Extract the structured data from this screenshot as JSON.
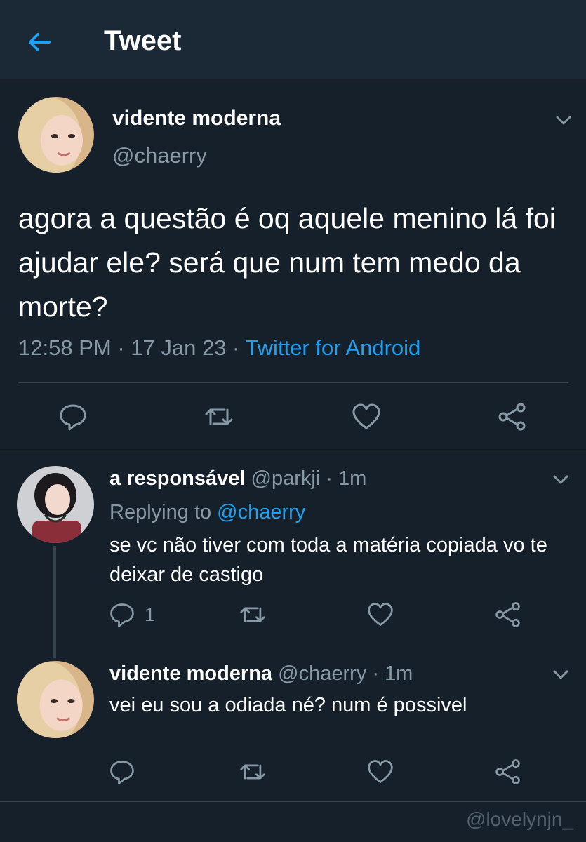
{
  "header": {
    "title": "Tweet"
  },
  "main_tweet": {
    "display_name": "vidente moderna",
    "handle": "@chaerry",
    "text": "agora a questão é oq aquele menino lá foi ajudar ele? será que num tem medo da morte?",
    "time": "12:58 PM",
    "date": "17 Jan 23",
    "source": "Twitter for Android"
  },
  "replies": [
    {
      "display_name": "a responsável",
      "handle": "@parkji",
      "time_ago": "1m",
      "replying_to_label": "Replying to",
      "replying_to": "@chaerry",
      "text": "se vc não tiver com toda a matéria copiada vo te deixar de castigo",
      "reply_count": "1"
    },
    {
      "display_name": "vidente moderna",
      "handle": "@chaerry",
      "time_ago": "1m",
      "text": "vei eu sou a odiada né? num é possivel"
    }
  ],
  "separator": " · ",
  "watermark": "@lovelynjn_",
  "colors": {
    "background": "#15202b",
    "header": "#1b2836",
    "accent": "#1da1f2",
    "muted": "#8899a6",
    "divider": "#38444d"
  },
  "icons": [
    "back-arrow-icon",
    "chevron-down-icon",
    "reply-icon",
    "retweet-icon",
    "like-icon",
    "share-icon"
  ]
}
